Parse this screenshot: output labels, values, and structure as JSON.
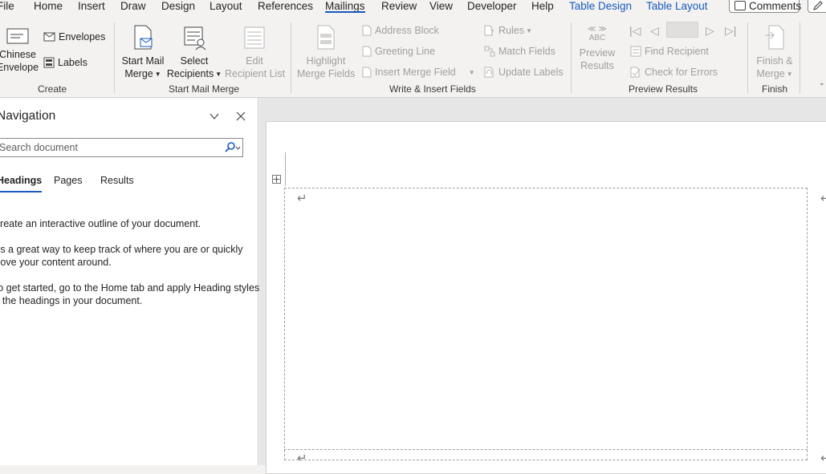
{
  "tabs": [
    "File",
    "Home",
    "Insert",
    "Draw",
    "Design",
    "Layout",
    "References",
    "Mailings",
    "Review",
    "View",
    "Developer",
    "Help",
    "Table Design",
    "Table Layout"
  ],
  "header": {
    "comments_label": "Comments"
  },
  "ribbon": {
    "create": {
      "chinese_envelope": [
        "Chinese",
        "Envelope"
      ],
      "envelopes": "Envelopes",
      "labels": "Labels",
      "group_label": "Create"
    },
    "start_mail_merge": {
      "start_mail_merge": [
        "Start Mail",
        "Merge"
      ],
      "select_recipients": [
        "Select",
        "Recipients"
      ],
      "edit_recipient_list": [
        "Edit",
        "Recipient List"
      ],
      "group_label": "Start Mail Merge"
    },
    "write_insert": {
      "highlight_merge_fields": [
        "Highlight",
        "Merge Fields"
      ],
      "address_block": "Address Block",
      "greeting_line": "Greeting Line",
      "insert_merge_field": "Insert Merge Field",
      "rules": "Rules",
      "match_fields": "Match Fields",
      "update_labels": "Update Labels",
      "group_label": "Write & Insert Fields"
    },
    "preview_results": {
      "preview_results": [
        "Preview",
        "Results"
      ],
      "abc_text": "ABC",
      "find_recipient": "Find Recipient",
      "check_for_errors": "Check for Errors",
      "group_label": "Preview Results"
    },
    "finish": {
      "finish_merge": [
        "Finish &",
        "Merge"
      ],
      "group_label": "Finish"
    }
  },
  "navigation": {
    "title": "Navigation",
    "search_placeholder": "Search document",
    "tabs": [
      "Headings",
      "Pages",
      "Results"
    ],
    "text": [
      "Create an interactive outline of your document.",
      "It's a great way to keep track of where you are or quickly",
      "move your content around.",
      "To get started, go to the Home tab and apply Heading styles",
      "to the headings in your document."
    ]
  },
  "document": {
    "paragraph_mark": "↵"
  },
  "colors": {
    "accent": "#185abd",
    "disabled": "#a19f9d"
  }
}
